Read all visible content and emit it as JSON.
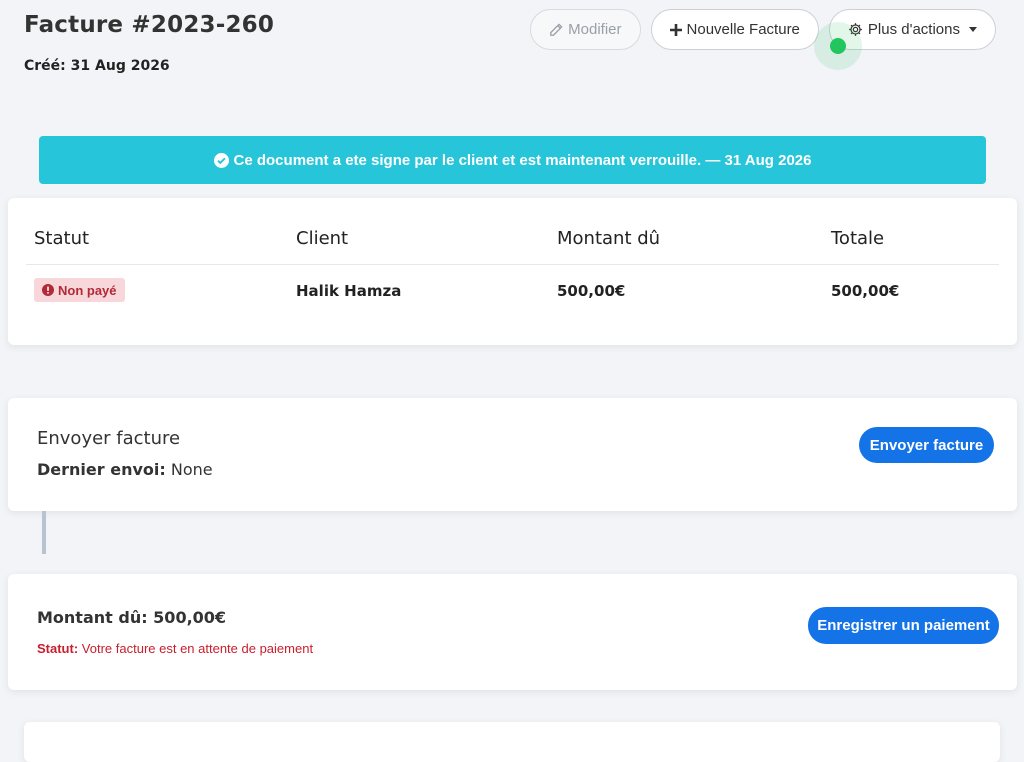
{
  "invoice": {
    "title": "Facture #2023-260",
    "created_label": "Créé:",
    "created_date": "31 Aug 2026"
  },
  "actions": {
    "edit_label": "Modifier",
    "new_invoice_label": "Nouvelle Facture",
    "more_actions_label": "Plus d'actions"
  },
  "alert": {
    "message": "Ce document a ete signe par le client et est maintenant verrouille. — 31 Aug 2026",
    "color": "#26c5da"
  },
  "summary": {
    "headers": [
      "Statut",
      "Client",
      "Montant dû",
      "Totale"
    ],
    "status_badge": "Non payé",
    "client": "Halik Hamza",
    "amount_due": "500,00€",
    "total": "500,00€"
  },
  "send_section": {
    "title": "Envoyer facture",
    "last_sent_label": "Dernier envoi:",
    "last_sent_value": "None",
    "button_label": "Envoyer facture"
  },
  "payment_section": {
    "amount_text": "Montant dû: 500,00€",
    "status_label": "Statut:",
    "status_text": "Votre facture est en attente de paiement",
    "button_label": "Enregistrer un paiement"
  },
  "colors": {
    "primary": "#1473e6",
    "danger": "#c81e2d",
    "badge_bg": "#f8d7da",
    "background": "#f3f4f8"
  }
}
